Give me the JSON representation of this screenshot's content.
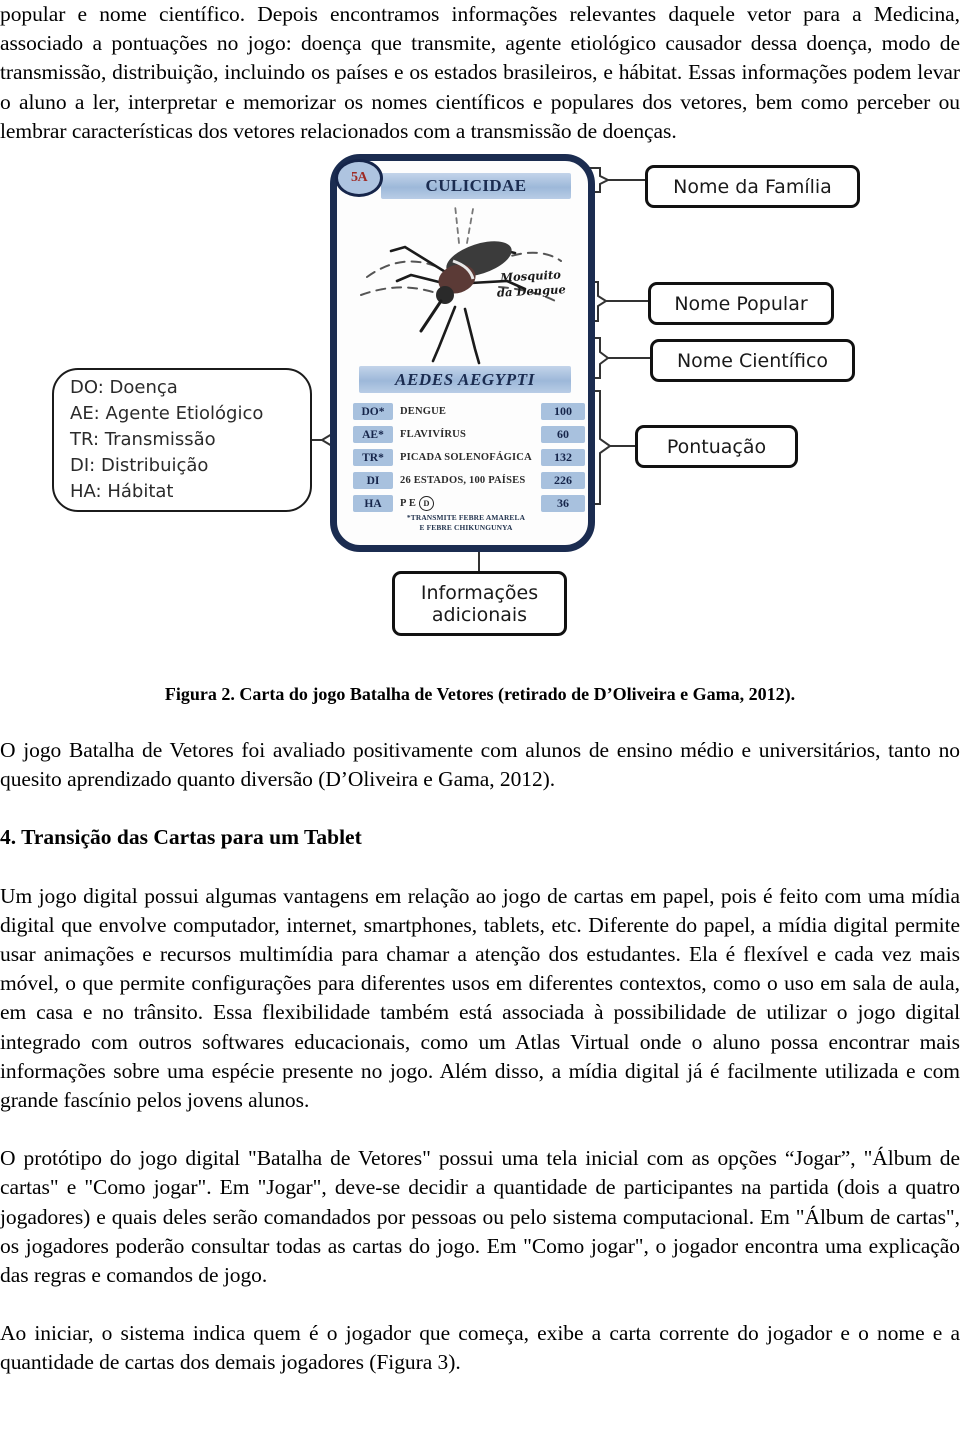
{
  "document": {
    "paragraphs": {
      "p1": "popular e nome científico. Depois encontramos informações relevantes daquele vetor para a Medicina, associado a pontuações no jogo: doença que transmite, agente etiológico causador dessa doença, modo de transmissão, distribuição, incluindo os países e os estados brasileiros, e hábitat. Essas informações podem levar o aluno a ler, interpretar e memorizar os nomes científicos e populares dos vetores, bem como perceber ou lembrar características dos vetores relacionados com a transmissão de doenças.",
      "p2": "O jogo Batalha de Vetores foi avaliado positivamente com alunos de ensino médio e universitários, tanto no quesito aprendizado quanto diversão (D’Oliveira e Gama, 2012).",
      "p3": "Um jogo digital possui algumas vantagens em relação ao jogo de cartas em papel, pois é feito com uma mídia digital que envolve computador, internet, smartphones, tablets, etc. Diferente do papel, a mídia digital permite usar animações e recursos multimídia para chamar a atenção dos estudantes. Ela é flexível e cada vez mais móvel, o que permite configurações para diferentes usos em diferentes contextos, como o uso em sala de aula, em casa e no trânsito. Essa flexibilidade também está associada à possibilidade de utilizar o jogo digital integrado com outros softwares educacionais, como um Atlas Virtual onde o aluno possa encontrar mais informações sobre uma espécie presente no jogo. Além disso, a mídia digital já é facilmente utilizada e com grande fascínio pelos jovens alunos.",
      "p4": "O protótipo do jogo digital \"Batalha de Vetores\" possui uma tela inicial com as opções “Jogar”, \"Álbum de cartas\" e \"Como jogar\". Em \"Jogar\", deve-se decidir a quantidade de participantes na partida (dois a quatro jogadores) e quais deles serão comandados por pessoas ou pelo sistema computacional. Em \"Álbum de cartas\", os jogadores poderão consultar todas as cartas do jogo. Em \"Como jogar\", o jogador encontra uma explicação das regras e comandos de jogo.",
      "p5": "Ao iniciar, o sistema indica quem é o jogador que começa, exibe a carta corrente do jogador e o nome e a quantidade de cartas dos demais jogadores (Figura 3)."
    },
    "headings": {
      "section4": "4. Transição das Cartas para um Tablet"
    },
    "caption": "Figura 2. Carta do jogo Batalha de Vetores (retirado de D’Oliveira e Gama, 2012)."
  },
  "figure": {
    "card": {
      "badge": "5A",
      "family_name": "CULICIDAE",
      "scientific_name": "AEDES AEGYPTI",
      "popular_name_line1": "Mosquito",
      "popular_name_line2": "da Dengue",
      "illustration": "mosquito-illustration",
      "table_rows": [
        {
          "key": "DO*",
          "value": "DENGUE",
          "points": "100"
        },
        {
          "key": "AE*",
          "value": "FLAVIVÍRUS",
          "points": "60"
        },
        {
          "key": "TR*",
          "value": "PICADA SOLENOFÁGICA",
          "points": "132"
        },
        {
          "key": "DI",
          "value": "26 ESTADOS, 100 PAÍSES",
          "points": "226"
        },
        {
          "key": "HA",
          "value": "P E",
          "value_circle": "D",
          "points": "36"
        }
      ],
      "footnote_line1": "*TRANSMITE FEBRE AMARELA",
      "footnote_line2": "E FEBRE CHIKUNGUNYA"
    },
    "callouts": {
      "familia": "Nome da Família",
      "popular": "Nome Popular",
      "cientifico": "Nome Científico",
      "pontuacao": "Pontuação",
      "info_line1": "Informações",
      "info_line2": "adicionais"
    },
    "legend": [
      {
        "abbr": "DO:",
        "term": "Doença"
      },
      {
        "abbr": "AE:",
        "term": "Agente Etiológico"
      },
      {
        "abbr": "TR:",
        "term": "Transmissão"
      },
      {
        "abbr": "DI:",
        "term": "Distribuição"
      },
      {
        "abbr": "HA:",
        "term": "Hábitat"
      }
    ]
  },
  "colors": {
    "card_border": "#1b2c50",
    "bar_blue": "#a8c1de",
    "badge_text": "#9e2a23",
    "callout_border": "#111111"
  }
}
